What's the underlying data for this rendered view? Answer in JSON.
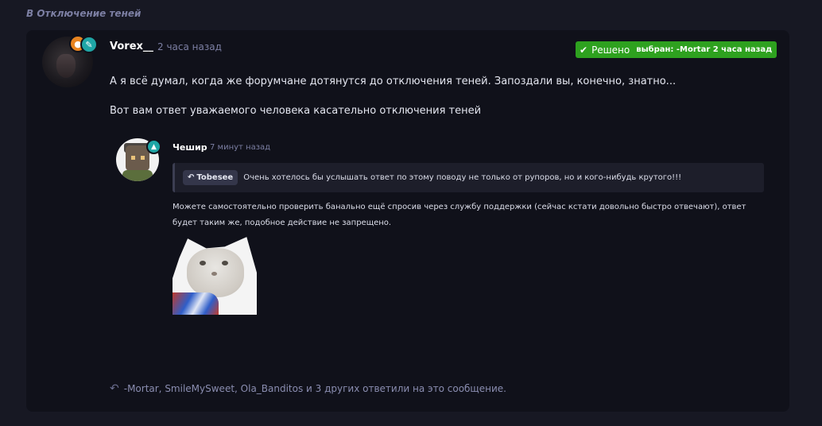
{
  "breadcrumb": "В Отключение теней",
  "post": {
    "author": "Vorex__",
    "time": "2 часа назад",
    "badges": [
      "orange-role-icon",
      "teal-chat-icon"
    ],
    "solved": {
      "label": "Решено",
      "chosen": "выбран: -Mortar 2 часа назад",
      "color": "#2ea11f"
    },
    "paragraphs": [
      "А я всё думал, когда же форумчане дотянутся до отключения теней. Запоздали вы, конечно, знатно...",
      "Вот вам ответ уважаемого человека касательно отключения теней"
    ]
  },
  "quote": {
    "author": "Чешир",
    "time": "7 минут назад",
    "reply_to": {
      "name": "Tobesee",
      "text": "Очень хотелось бы услышать ответ по этому поводу не только от рупоров, но и кого-нибудь крутого!!!"
    },
    "lines": [
      "Можете самостоятельно проверить банально ещё спросив через службу поддержки (сейчас кстати довольно быстро отвечают), ответ",
      "будет таким же, подобное действие не запрещено."
    ]
  },
  "replies_summary": "-Mortar, SmileMySweet, Ola_Banditos и 3 других ответили на это сообщение."
}
